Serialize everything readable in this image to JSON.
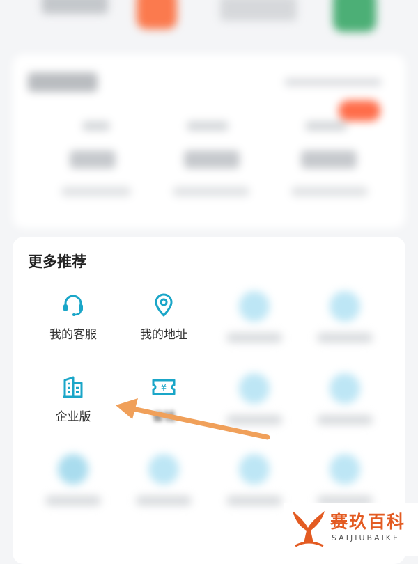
{
  "more_section": {
    "title": "更多推荐",
    "items": [
      {
        "label": "我的客服",
        "icon": "headset-icon"
      },
      {
        "label": "我的地址",
        "icon": "location-pin-icon"
      },
      {
        "label": "企业版",
        "icon": "building-icon"
      },
      {
        "label": "省钱",
        "icon": "coupon-icon"
      }
    ]
  },
  "watermark": {
    "title": "赛玖百科",
    "subtitle": "SAIJIUBAIKE"
  },
  "colors": {
    "accent": "#1aa6c8",
    "arrow": "#f0a05a",
    "watermark": "#e35b22"
  }
}
